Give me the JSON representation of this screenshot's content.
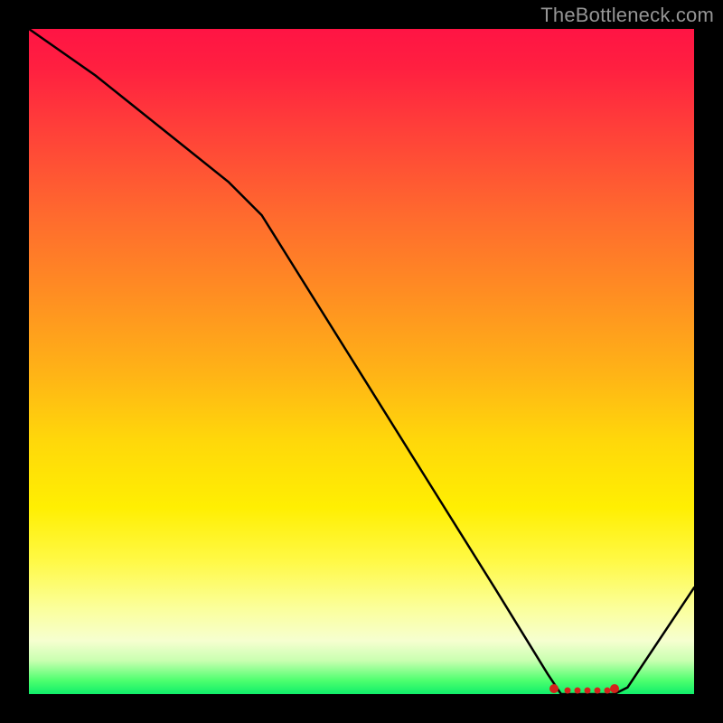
{
  "watermark": "TheBottleneck.com",
  "chart_data": {
    "type": "line",
    "title": "",
    "xlabel": "",
    "ylabel": "",
    "xlim": [
      0,
      100
    ],
    "ylim": [
      0,
      100
    ],
    "grid": false,
    "legend": false,
    "series": [
      {
        "name": "curve",
        "x": [
          0,
          10,
          20,
          30,
          35,
          40,
          50,
          60,
          70,
          78,
          80,
          82,
          84,
          86,
          88,
          90,
          100
        ],
        "y": [
          100,
          93,
          85,
          77,
          72,
          64,
          48,
          32,
          16,
          3,
          0,
          0,
          0,
          0,
          0,
          1,
          16
        ]
      }
    ],
    "highlight": {
      "name": "optimal-range",
      "x": [
        79,
        81,
        82.5,
        84,
        85.5,
        87,
        88
      ],
      "y": [
        0.8,
        0.6,
        0.5,
        0.5,
        0.5,
        0.6,
        0.8
      ]
    },
    "gradient_stops": [
      {
        "pos": 0,
        "color": "#ff1444"
      },
      {
        "pos": 28,
        "color": "#ff6a2e"
      },
      {
        "pos": 62,
        "color": "#ffd80a"
      },
      {
        "pos": 92,
        "color": "#f6ffd0"
      },
      {
        "pos": 100,
        "color": "#10ee6a"
      }
    ]
  }
}
